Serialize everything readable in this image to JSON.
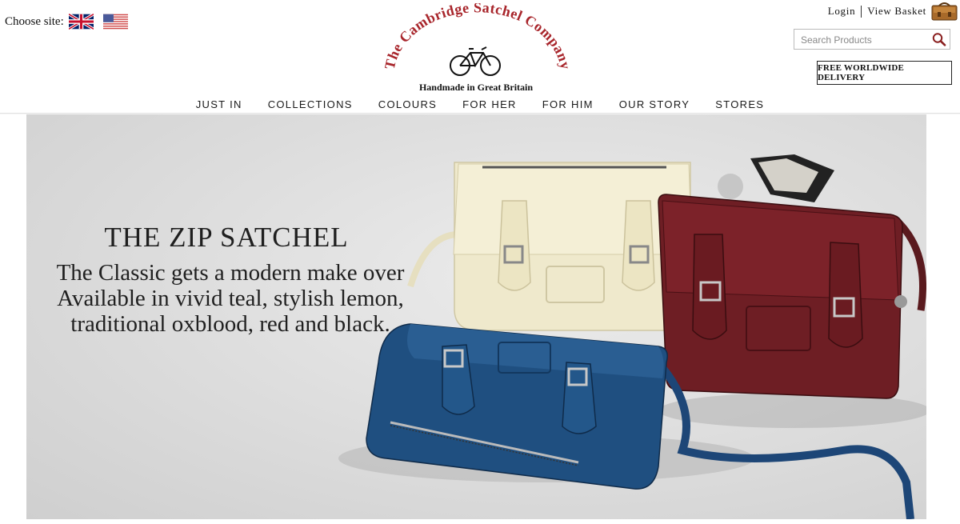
{
  "header": {
    "choose_site_label": "Choose site:",
    "sites": [
      {
        "name": "uk-flag-icon"
      },
      {
        "name": "us-flag-icon"
      }
    ],
    "login_label": "Login",
    "basket_label": "View Basket",
    "basket_icon": "basket-icon",
    "search": {
      "placeholder": "Search Products",
      "value": "",
      "icon": "search-icon"
    },
    "delivery_badge": "FREE WORLDWIDE DELIVERY"
  },
  "logo": {
    "brand": "The Cambridge Satchel Company",
    "tagline": "Handmade in Great Britain",
    "icon": "bicycle-icon"
  },
  "nav": {
    "items": [
      {
        "label": "JUST IN"
      },
      {
        "label": "COLLECTIONS"
      },
      {
        "label": "COLOURS"
      },
      {
        "label": "FOR HER"
      },
      {
        "label": "FOR HIM"
      },
      {
        "label": "OUR STORY"
      },
      {
        "label": "STORES"
      }
    ]
  },
  "hero": {
    "title": "THE ZIP SATCHEL",
    "lines": [
      "The Classic gets a modern make over",
      "Available in vivid teal, stylish lemon,",
      "traditional oxblood, red and black."
    ]
  },
  "colors": {
    "logo_red": "#a8252b",
    "teal_bag": "#1f4f80",
    "lemon_bag": "#f0ead0",
    "oxblood_bag": "#6e1e24",
    "hero_bg": "#dcdcdc"
  }
}
